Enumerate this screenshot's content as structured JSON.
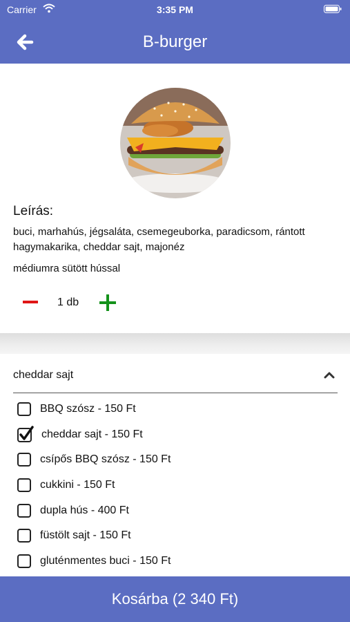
{
  "status_bar": {
    "carrier": "Carrier",
    "time": "3:35 PM"
  },
  "header": {
    "title": "B-burger",
    "back_icon": "arrow-left-icon",
    "color": "#5b6dc2"
  },
  "product": {
    "description_label": "Leírás:",
    "description": "buci, marhahús, jégsaláta, csemegeuborka, paradicsom, rántott hagymakarika, cheddar sajt, majonéz",
    "note": "médiumra sütött hússal",
    "quantity": "1 db"
  },
  "extras": {
    "selected_summary": "cheddar sajt",
    "options": [
      {
        "label": "BBQ szósz - 150 Ft",
        "checked": false
      },
      {
        "label": "cheddar sajt - 150 Ft",
        "checked": true
      },
      {
        "label": "csípős BBQ szósz - 150 Ft",
        "checked": false
      },
      {
        "label": "cukkini - 150 Ft",
        "checked": false
      },
      {
        "label": "dupla hús - 400 Ft",
        "checked": false
      },
      {
        "label": "füstölt sajt - 150 Ft",
        "checked": false
      },
      {
        "label": "gluténmentes buci - 150 Ft",
        "checked": false
      }
    ]
  },
  "cart": {
    "label": "Kosárba (2 340 Ft)"
  },
  "colors": {
    "accent": "#5b6dc2",
    "minus": "#e01616",
    "plus": "#14921b"
  }
}
